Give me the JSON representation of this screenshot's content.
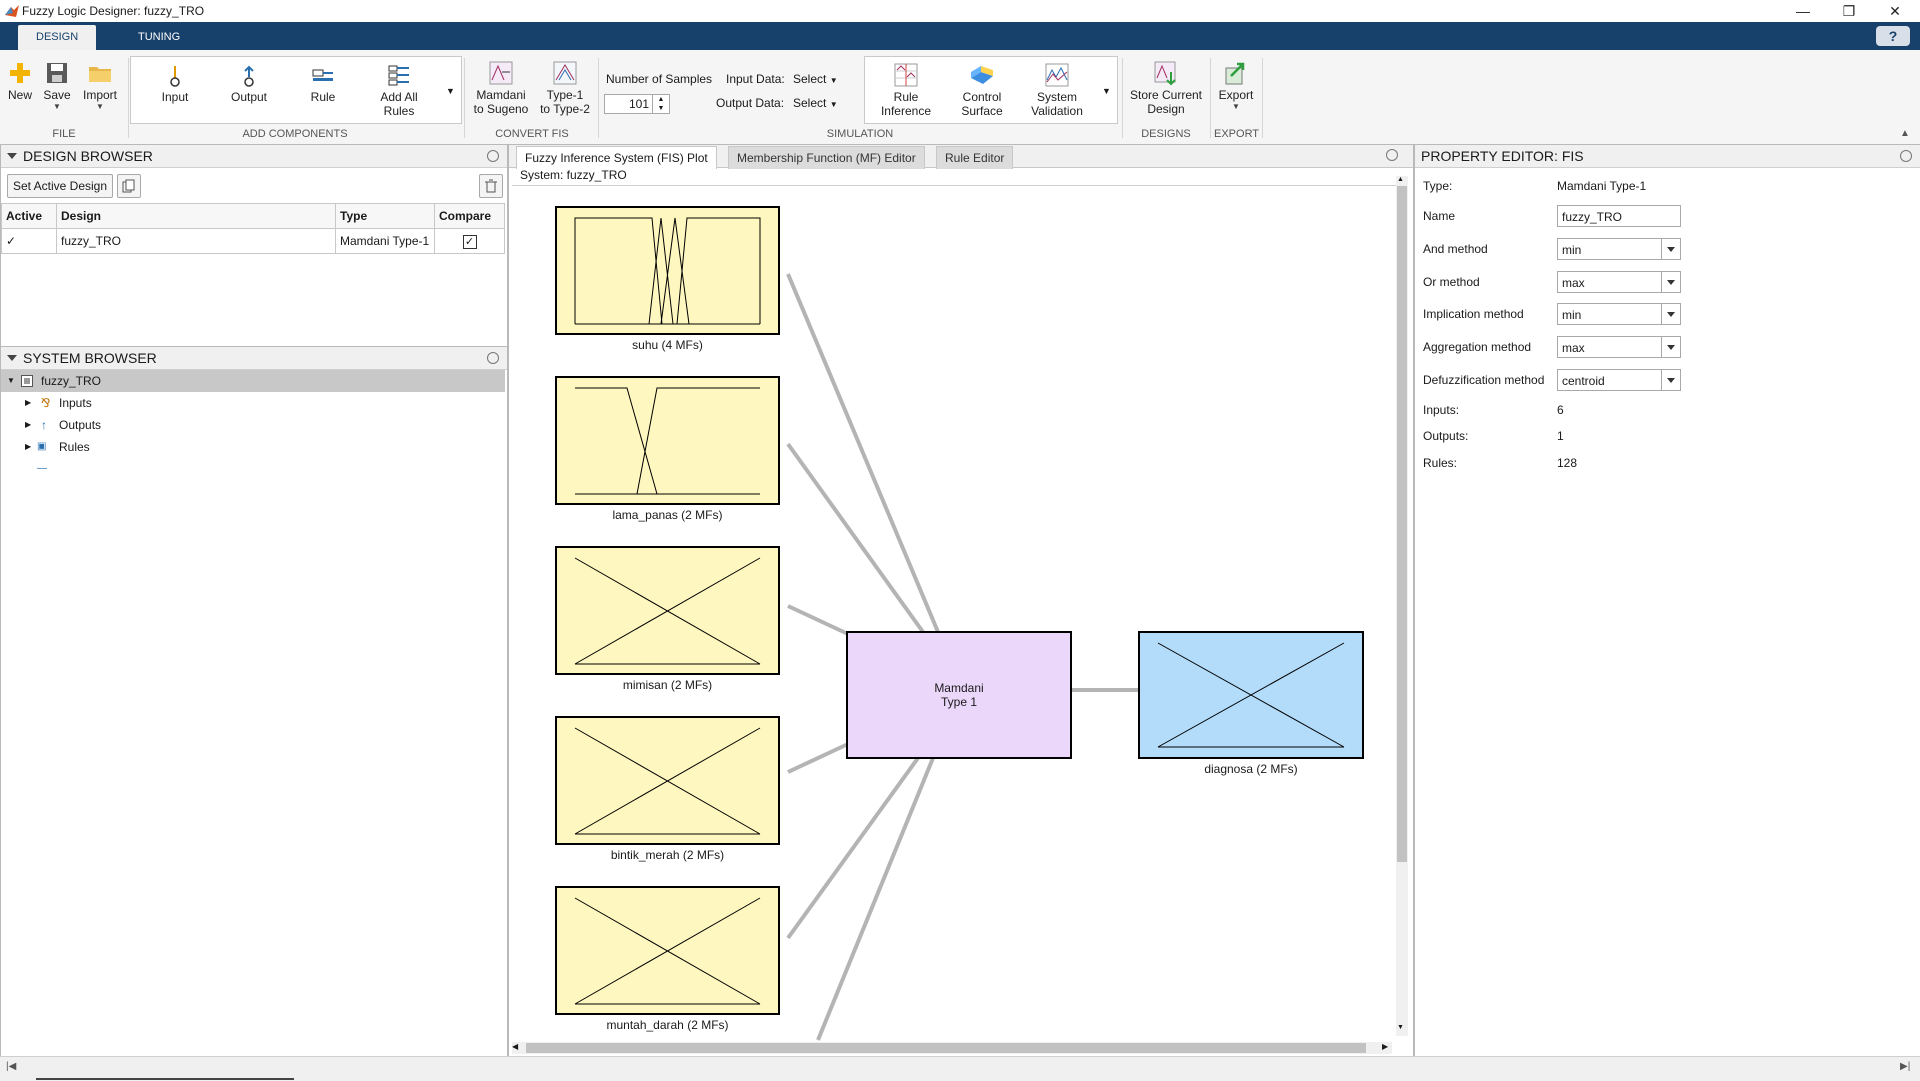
{
  "window": {
    "title": "Fuzzy Logic Designer: fuzzy_TRO"
  },
  "tabs": [
    "DESIGN",
    "TUNING"
  ],
  "help_label": "?",
  "toolstrip": {
    "file": {
      "new": "New",
      "save": "Save",
      "import": "Import",
      "section": "FILE"
    },
    "add": {
      "input": "Input",
      "output": "Output",
      "rule": "Rule",
      "add_all_rules_1": "Add All",
      "add_all_rules_2": "Rules",
      "section": "ADD COMPONENTS"
    },
    "convert": {
      "m2s_1": "Mamdani",
      "m2s_2": "to Sugeno",
      "t1_1": "Type-1",
      "t1_2": "to Type-2",
      "section": "CONVERT FIS"
    },
    "simulation": {
      "num_samples_label": "Number of Samples",
      "num_samples_value": "101",
      "input_data_label": "Input Data:",
      "input_data_value": "Select",
      "output_data_label": "Output Data:",
      "output_data_value": "Select",
      "rule_inf_1": "Rule",
      "rule_inf_2": "Inference",
      "ctrl_surf_1": "Control",
      "ctrl_surf_2": "Surface",
      "sys_val_1": "System",
      "sys_val_2": "Validation",
      "section": "SIMULATION"
    },
    "designs": {
      "store_1": "Store Current",
      "store_2": "Design",
      "section": "DESIGNS"
    },
    "export": {
      "label": "Export",
      "section": "EXPORT"
    }
  },
  "design_browser": {
    "title": "DESIGN BROWSER",
    "set_active": "Set Active Design",
    "columns": [
      "Active",
      "Design",
      "Type",
      "Compare"
    ],
    "rows": [
      {
        "active": "✓",
        "design": "fuzzy_TRO",
        "type": "Mamdani Type-1",
        "compare": true
      }
    ]
  },
  "system_browser": {
    "title": "SYSTEM BROWSER",
    "root": "fuzzy_TRO",
    "children": [
      "Inputs",
      "Outputs",
      "Rules"
    ]
  },
  "doc_tabs": [
    "Fuzzy Inference System (FIS) Plot",
    "Membership Function (MF) Editor",
    "Rule Editor"
  ],
  "fis_plot": {
    "system_label": "System: fuzzy_TRO",
    "inputs": [
      "suhu (4 MFs)",
      "lama_panas (2 MFs)",
      "mimisan (2 MFs)",
      "bintik_merah (2 MFs)",
      "muntah_darah (2 MFs)"
    ],
    "fis_box_1": "Mamdani",
    "fis_box_2": "Type 1",
    "output": "diagnosa (2 MFs)",
    "colors": {
      "input_fill": "#fff7c0",
      "fis_fill": "#ebd7fa",
      "output_fill": "#b3dcfa"
    }
  },
  "property_editor": {
    "title": "PROPERTY EDITOR: FIS",
    "type_label": "Type:",
    "type_value": "Mamdani Type-1",
    "name_label": "Name",
    "name_value": "fuzzy_TRO",
    "and_label": "And method",
    "and_value": "min",
    "or_label": "Or method",
    "or_value": "max",
    "imp_label": "Implication method",
    "imp_value": "min",
    "agg_label": "Aggregation method",
    "agg_value": "max",
    "defuzz_label": "Defuzzification method",
    "defuzz_value": "centroid",
    "inputs_label": "Inputs:",
    "inputs_value": "6",
    "outputs_label": "Outputs:",
    "outputs_value": "1",
    "rules_label": "Rules:",
    "rules_value": "128"
  },
  "colors": {
    "tab_strip": "#17406a"
  }
}
